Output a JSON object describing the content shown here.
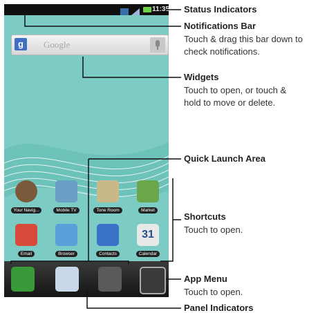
{
  "phone": {
    "status_time": "11:35",
    "search_placeholder": "Google",
    "apps_row1": [
      {
        "label": "Your Navig...",
        "icon": "navigation-compass-icon",
        "color": "#7a5a3a"
      },
      {
        "label": "Mobile TV",
        "icon": "tv-icon",
        "color": "#6aa0c8"
      },
      {
        "label": "Tone Room",
        "icon": "music-note-icon",
        "color": "#c9b88a"
      },
      {
        "label": "Market",
        "icon": "market-bag-icon",
        "color": "#6aa64a"
      }
    ],
    "apps_row2": [
      {
        "label": "Email",
        "icon": "email-at-icon",
        "color": "#d84a3a"
      },
      {
        "label": "Browser",
        "icon": "globe-map-icon",
        "color": "#5aa0d8"
      },
      {
        "label": "Contacts",
        "icon": "contacts-book-icon",
        "color": "#3a72c8"
      },
      {
        "label": "Calendar",
        "icon": "calendar-icon",
        "color": "#e8e8e8",
        "text": "31"
      }
    ],
    "dock": [
      {
        "name": "phone-icon",
        "color": "#3a9a3a"
      },
      {
        "name": "messaging-envelope-icon",
        "color": "#c8d8e8"
      },
      {
        "name": "camera-icon",
        "color": "#5a5a5a"
      },
      {
        "name": "app-menu-icon",
        "color": "#3a3a3a"
      }
    ]
  },
  "callouts": {
    "status_indicators": {
      "title": "Status Indicators"
    },
    "notifications_bar": {
      "title": "Notifications Bar",
      "desc1": "Touch & drag this bar down to",
      "desc2": "check notifications."
    },
    "widgets": {
      "title": "Widgets",
      "desc1": "Touch to open, or touch &",
      "desc2": "hold to move or delete."
    },
    "quick_launch": {
      "title": "Quick Launch Area"
    },
    "shortcuts": {
      "title": "Shortcuts",
      "desc1": "Touch to open."
    },
    "app_menu": {
      "title": "App Menu",
      "desc1": "Touch to open."
    },
    "panel_indicators": {
      "title": "Panel Indicators"
    }
  },
  "colors": {
    "accent": "#101010",
    "wallpaper": "#6fc4be"
  }
}
